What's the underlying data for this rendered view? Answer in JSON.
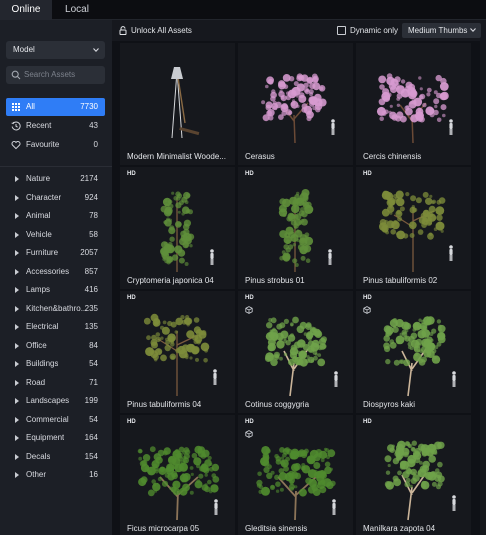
{
  "tabs": [
    {
      "label": "Online",
      "active": true
    },
    {
      "label": "Local",
      "active": false
    }
  ],
  "sidebar": {
    "dropdown": {
      "value": "Model"
    },
    "search": {
      "placeholder": "Search Assets"
    },
    "nav": [
      {
        "label": "All",
        "count": "7730",
        "icon": "grid-icon",
        "active": true
      },
      {
        "label": "Recent",
        "count": "43",
        "icon": "history-icon",
        "active": false
      },
      {
        "label": "Favourite",
        "count": "0",
        "icon": "heart-icon",
        "active": false
      }
    ],
    "categories": [
      {
        "label": "Nature",
        "count": "2174"
      },
      {
        "label": "Character",
        "count": "924"
      },
      {
        "label": "Animal",
        "count": "78"
      },
      {
        "label": "Vehicle",
        "count": "58"
      },
      {
        "label": "Furniture",
        "count": "2057"
      },
      {
        "label": "Accessories",
        "count": "857"
      },
      {
        "label": "Lamps",
        "count": "416"
      },
      {
        "label": "Kitchen&bathro...",
        "count": "235"
      },
      {
        "label": "Electrical",
        "count": "135"
      },
      {
        "label": "Office",
        "count": "84"
      },
      {
        "label": "Buildings",
        "count": "54"
      },
      {
        "label": "Road",
        "count": "71"
      },
      {
        "label": "Landscapes",
        "count": "199"
      },
      {
        "label": "Commercial",
        "count": "54"
      },
      {
        "label": "Equipment",
        "count": "164"
      },
      {
        "label": "Decals",
        "count": "154"
      },
      {
        "label": "Other",
        "count": "16"
      }
    ]
  },
  "toolbar": {
    "unlock_label": "Unlock All Assets",
    "dynamic_label": "Dynamic only",
    "thumb_size": "Medium Thumbs"
  },
  "assets": [
    {
      "name": "Modern Minimalist Woode...",
      "hd": "",
      "cube": false,
      "kind": "lamp"
    },
    {
      "name": "Cerasus",
      "hd": "",
      "cube": false,
      "kind": "pink"
    },
    {
      "name": "Cercis chinensis",
      "hd": "",
      "cube": false,
      "kind": "pink"
    },
    {
      "name": "Cryptomeria japonica 04",
      "hd": "HD",
      "cube": false,
      "kind": "conifer"
    },
    {
      "name": "Pinus strobus 01",
      "hd": "HD",
      "cube": false,
      "kind": "conifer"
    },
    {
      "name": "Pinus tabuliformis 02",
      "hd": "HD",
      "cube": false,
      "kind": "pine"
    },
    {
      "name": "Pinus tabuliformis 04",
      "hd": "HD",
      "cube": false,
      "kind": "pine"
    },
    {
      "name": "Cotinus coggygria",
      "hd": "HD",
      "cube": true,
      "kind": "round"
    },
    {
      "name": "Diospyros kaki",
      "hd": "HD",
      "cube": true,
      "kind": "round"
    },
    {
      "name": "Ficus microcarpa 05",
      "hd": "HD",
      "cube": false,
      "kind": "wide"
    },
    {
      "name": "Gleditsia sinensis",
      "hd": "HD",
      "cube": true,
      "kind": "wide"
    },
    {
      "name": "Manilkara zapota 04",
      "hd": "HD",
      "cube": false,
      "kind": "round"
    }
  ],
  "colors": {
    "accent": "#2f7df6",
    "sidebar_bg": "#1c1f26",
    "card_bg": "#16181d",
    "blossom": "#d79ad0",
    "foliage": "#5f8f3a"
  }
}
